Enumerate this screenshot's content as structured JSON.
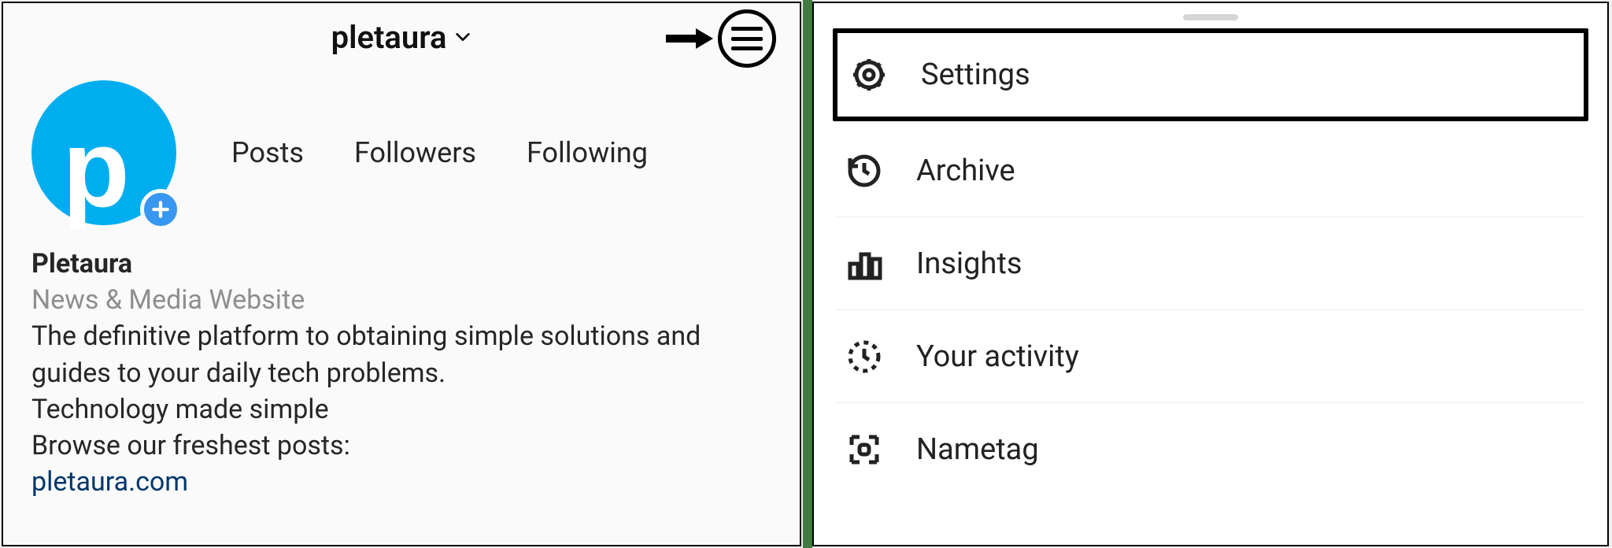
{
  "left": {
    "username": "pletaura",
    "avatar_letter": "p",
    "stats": {
      "posts": "Posts",
      "followers": "Followers",
      "following": "Following"
    },
    "bio": {
      "display_name": "Pletaura",
      "category": "News & Media Website",
      "line1": "The definitive platform to obtaining simple solutions and guides to your daily tech problems.",
      "line2": "Technology made simple",
      "line3": "Browse our freshest posts:",
      "link": "pletaura.com"
    }
  },
  "right": {
    "items": [
      {
        "label": "Settings"
      },
      {
        "label": "Archive"
      },
      {
        "label": "Insights"
      },
      {
        "label": "Your activity"
      },
      {
        "label": "Nametag"
      }
    ]
  }
}
